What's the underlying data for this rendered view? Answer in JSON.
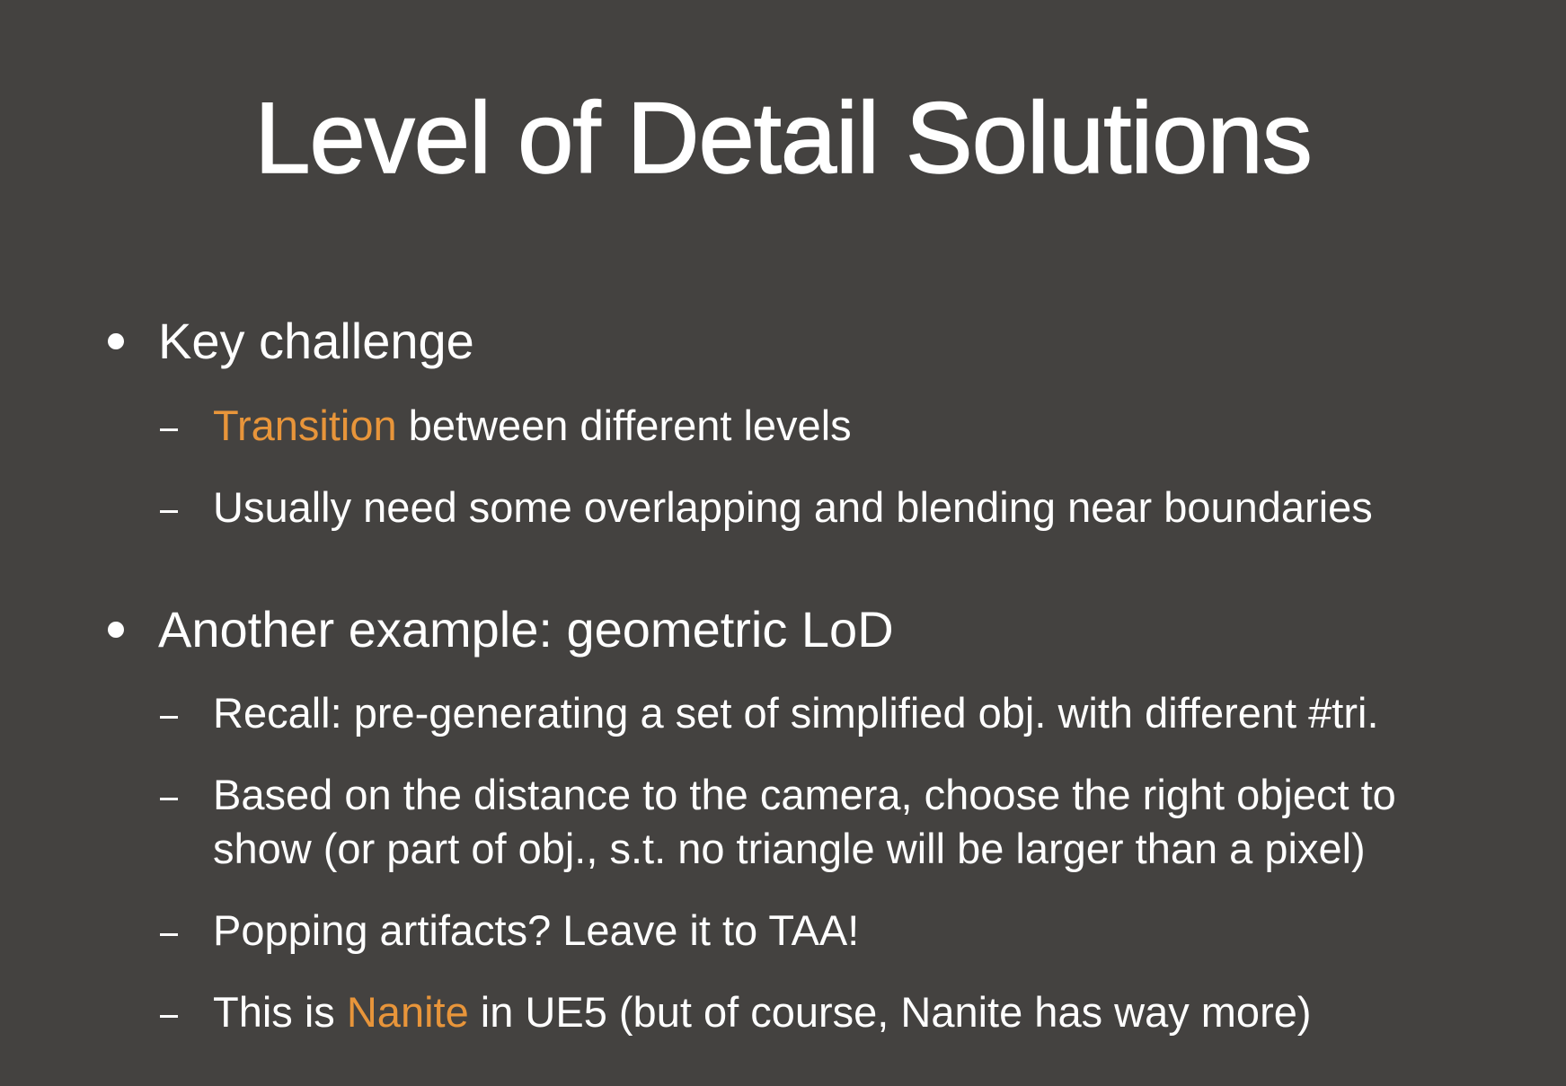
{
  "slide": {
    "title": "Level of Detail Solutions",
    "accent_color": "#e8953a",
    "background_color": "#444240",
    "bullet1": {
      "text": "Key challenge",
      "sub1": {
        "highlight": "Transition",
        "rest": " between different levels"
      },
      "sub2": {
        "text": "Usually need some overlapping and blending near boundaries"
      }
    },
    "bullet2": {
      "text": "Another example: geometric LoD",
      "sub1": {
        "text": "Recall: pre-generating a set of simplified obj. with different #tri."
      },
      "sub2": {
        "line1": "Based on the distance to the camera, choose the right object to",
        "line2": "show (or part of obj., s.t. no triangle will be larger than a pixel)"
      },
      "sub3": {
        "text": "Popping artifacts? Leave it to TAA!"
      },
      "sub4": {
        "before": "This is ",
        "highlight": "Nanite",
        "after": " in UE5 (but of course, Nanite has way more)"
      }
    }
  }
}
